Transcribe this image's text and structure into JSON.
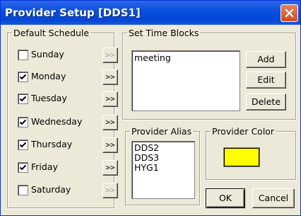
{
  "window": {
    "title": "Provider Setup [DDS1]"
  },
  "schedule": {
    "legend": "Default Schedule",
    "days": [
      {
        "label": "Sunday",
        "checked": false,
        "button": ">>",
        "button_enabled": false
      },
      {
        "label": "Monday",
        "checked": true,
        "button": ">>",
        "button_enabled": true
      },
      {
        "label": "Tuesday",
        "checked": true,
        "button": ">>",
        "button_enabled": true
      },
      {
        "label": "Wednesday",
        "checked": true,
        "button": ">>",
        "button_enabled": true
      },
      {
        "label": "Thursday",
        "checked": true,
        "button": ">>",
        "button_enabled": true
      },
      {
        "label": "Friday",
        "checked": true,
        "button": ">>",
        "button_enabled": true
      },
      {
        "label": "Saturday",
        "checked": false,
        "button": ">>",
        "button_enabled": false
      }
    ]
  },
  "time_blocks": {
    "legend": "Set Time Blocks",
    "items": [
      "meeting"
    ],
    "add_label": "Add",
    "edit_label": "Edit",
    "delete_label": "Delete"
  },
  "alias": {
    "legend": "Provider Alias",
    "items": [
      "DDS2",
      "DDS3",
      "HYG1"
    ]
  },
  "color": {
    "legend": "Provider Color",
    "value": "#ffff00"
  },
  "footer": {
    "ok_label": "OK",
    "cancel_label": "Cancel"
  }
}
